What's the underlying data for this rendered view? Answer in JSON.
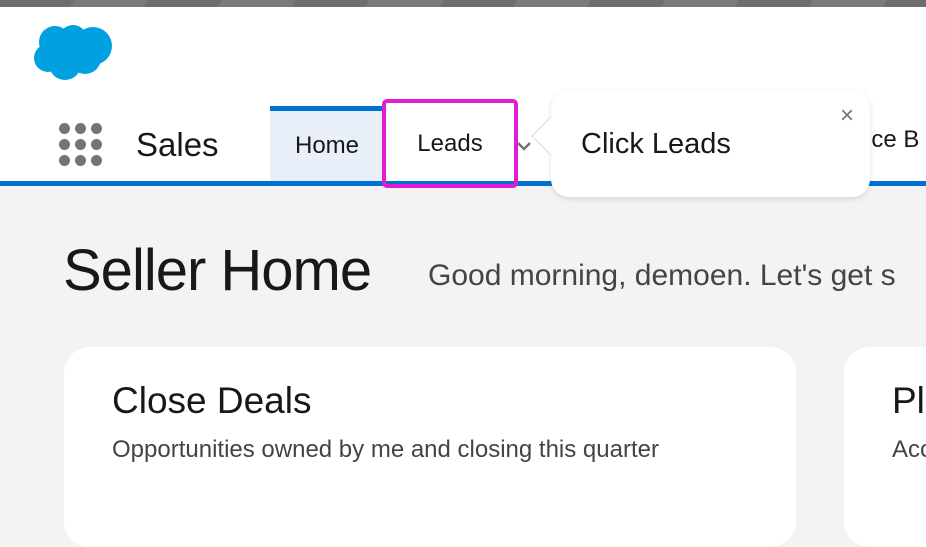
{
  "header": {
    "logo": "salesforce-cloud-logo"
  },
  "navbar": {
    "app_name": "Sales",
    "tabs": [
      {
        "label": "Home",
        "active": true
      },
      {
        "label": "Leads",
        "active": false
      }
    ],
    "overflow_tab_label": "rice B"
  },
  "popover": {
    "text": "Click Leads",
    "close_icon": "×"
  },
  "page": {
    "title": "Seller Home",
    "greeting": "Good morning, demoen. Let's get s"
  },
  "cards": [
    {
      "title": "Close Deals",
      "subtitle": "Opportunities owned by me and closing this quarter"
    },
    {
      "title": "Pl",
      "subtitle": "Acc"
    }
  ],
  "colors": {
    "brand": "#0070d2",
    "highlight": "#e01cd5",
    "logo": "#00a1e0"
  }
}
